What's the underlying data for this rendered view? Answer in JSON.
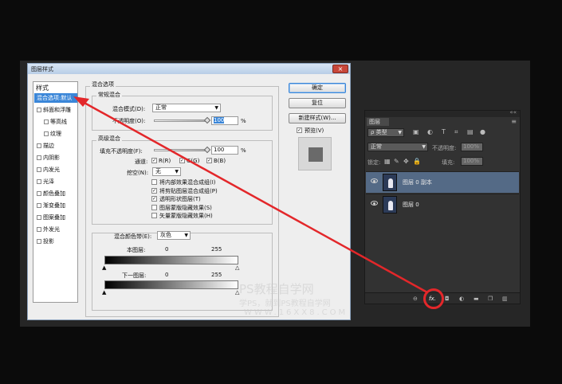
{
  "dialog": {
    "title": "图层样式",
    "close_label": "×",
    "styles_header": "样式",
    "styles": [
      {
        "label": "混合选项:默认",
        "checkbox": false,
        "indent": false,
        "selected": true
      },
      {
        "label": "斜面和浮雕",
        "checkbox": true,
        "indent": false,
        "selected": false
      },
      {
        "label": "等高线",
        "checkbox": true,
        "indent": true,
        "selected": false
      },
      {
        "label": "纹理",
        "checkbox": true,
        "indent": true,
        "selected": false
      },
      {
        "label": "描边",
        "checkbox": true,
        "indent": false,
        "selected": false
      },
      {
        "label": "内阴影",
        "checkbox": true,
        "indent": false,
        "selected": false
      },
      {
        "label": "内发光",
        "checkbox": true,
        "indent": false,
        "selected": false
      },
      {
        "label": "光泽",
        "checkbox": true,
        "indent": false,
        "selected": false
      },
      {
        "label": "颜色叠加",
        "checkbox": true,
        "indent": false,
        "selected": false
      },
      {
        "label": "渐变叠加",
        "checkbox": true,
        "indent": false,
        "selected": false
      },
      {
        "label": "图案叠加",
        "checkbox": true,
        "indent": false,
        "selected": false
      },
      {
        "label": "外发光",
        "checkbox": true,
        "indent": false,
        "selected": false
      },
      {
        "label": "投影",
        "checkbox": true,
        "indent": false,
        "selected": false
      }
    ],
    "blend_options": {
      "section_title": "混合选项",
      "general_title": "常规混合",
      "blend_mode_label": "混合模式(D):",
      "blend_mode_value": "正常",
      "opacity_label": "不透明度(O):",
      "opacity_value": "100",
      "opacity_unit": "%",
      "advanced_title": "高级混合",
      "fill_opacity_label": "填充不透明度(F):",
      "fill_opacity_value": "100",
      "fill_opacity_unit": "%",
      "channels_label": "通道:",
      "channel_r": "R(R)",
      "channel_g": "G(G)",
      "channel_b": "B(B)",
      "knockout_label": "挖空(N):",
      "knockout_value": "无",
      "options": [
        {
          "label": "将内部效果混合成组(I)",
          "checked": false
        },
        {
          "label": "将剪贴图层混合成组(P)",
          "checked": true
        },
        {
          "label": "透明形状图层(T)",
          "checked": true
        },
        {
          "label": "图层蒙版隐藏效果(S)",
          "checked": false
        },
        {
          "label": "矢量蒙版隐藏效果(H)",
          "checked": false
        }
      ],
      "blend_if_label": "混合颜色带(E):",
      "blend_if_value": "灰色",
      "this_layer_label": "本图层:",
      "this_layer_min": "0",
      "this_layer_max": "255",
      "underlying_label": "下一图层:",
      "underlying_min": "0",
      "underlying_max": "255"
    },
    "buttons": {
      "ok": "确定",
      "reset": "复位",
      "new_style": "新建样式(W)...",
      "preview": "预览(V)"
    }
  },
  "layers_panel": {
    "collapse_icon": "««",
    "tab_label": "图层",
    "menu_icon": "≡",
    "filter_label": "ρ 类型",
    "blend_mode": "正常",
    "opacity_label": "不透明度:",
    "opacity_value": "100%",
    "lock_label": "锁定:",
    "fill_label": "填充:",
    "fill_value": "100%",
    "layers": [
      {
        "name": "图层 0 副本",
        "active": true
      },
      {
        "name": "图层 0",
        "active": false
      }
    ],
    "bottom_icons": [
      "link-icon",
      "fx-icon",
      "mask-icon",
      "adjustment-icon",
      "folder-icon",
      "new-layer-icon",
      "trash-icon"
    ],
    "fx_label": "fx."
  },
  "watermark": {
    "line1": "PS教程自学网",
    "line2": "学PS，就到PS教程自学网",
    "line3": "WWW.16XX8.COM"
  },
  "colors": {
    "annotation_red": "#e3272a",
    "selection_blue": "#3a86d8",
    "active_layer": "#546a86"
  }
}
